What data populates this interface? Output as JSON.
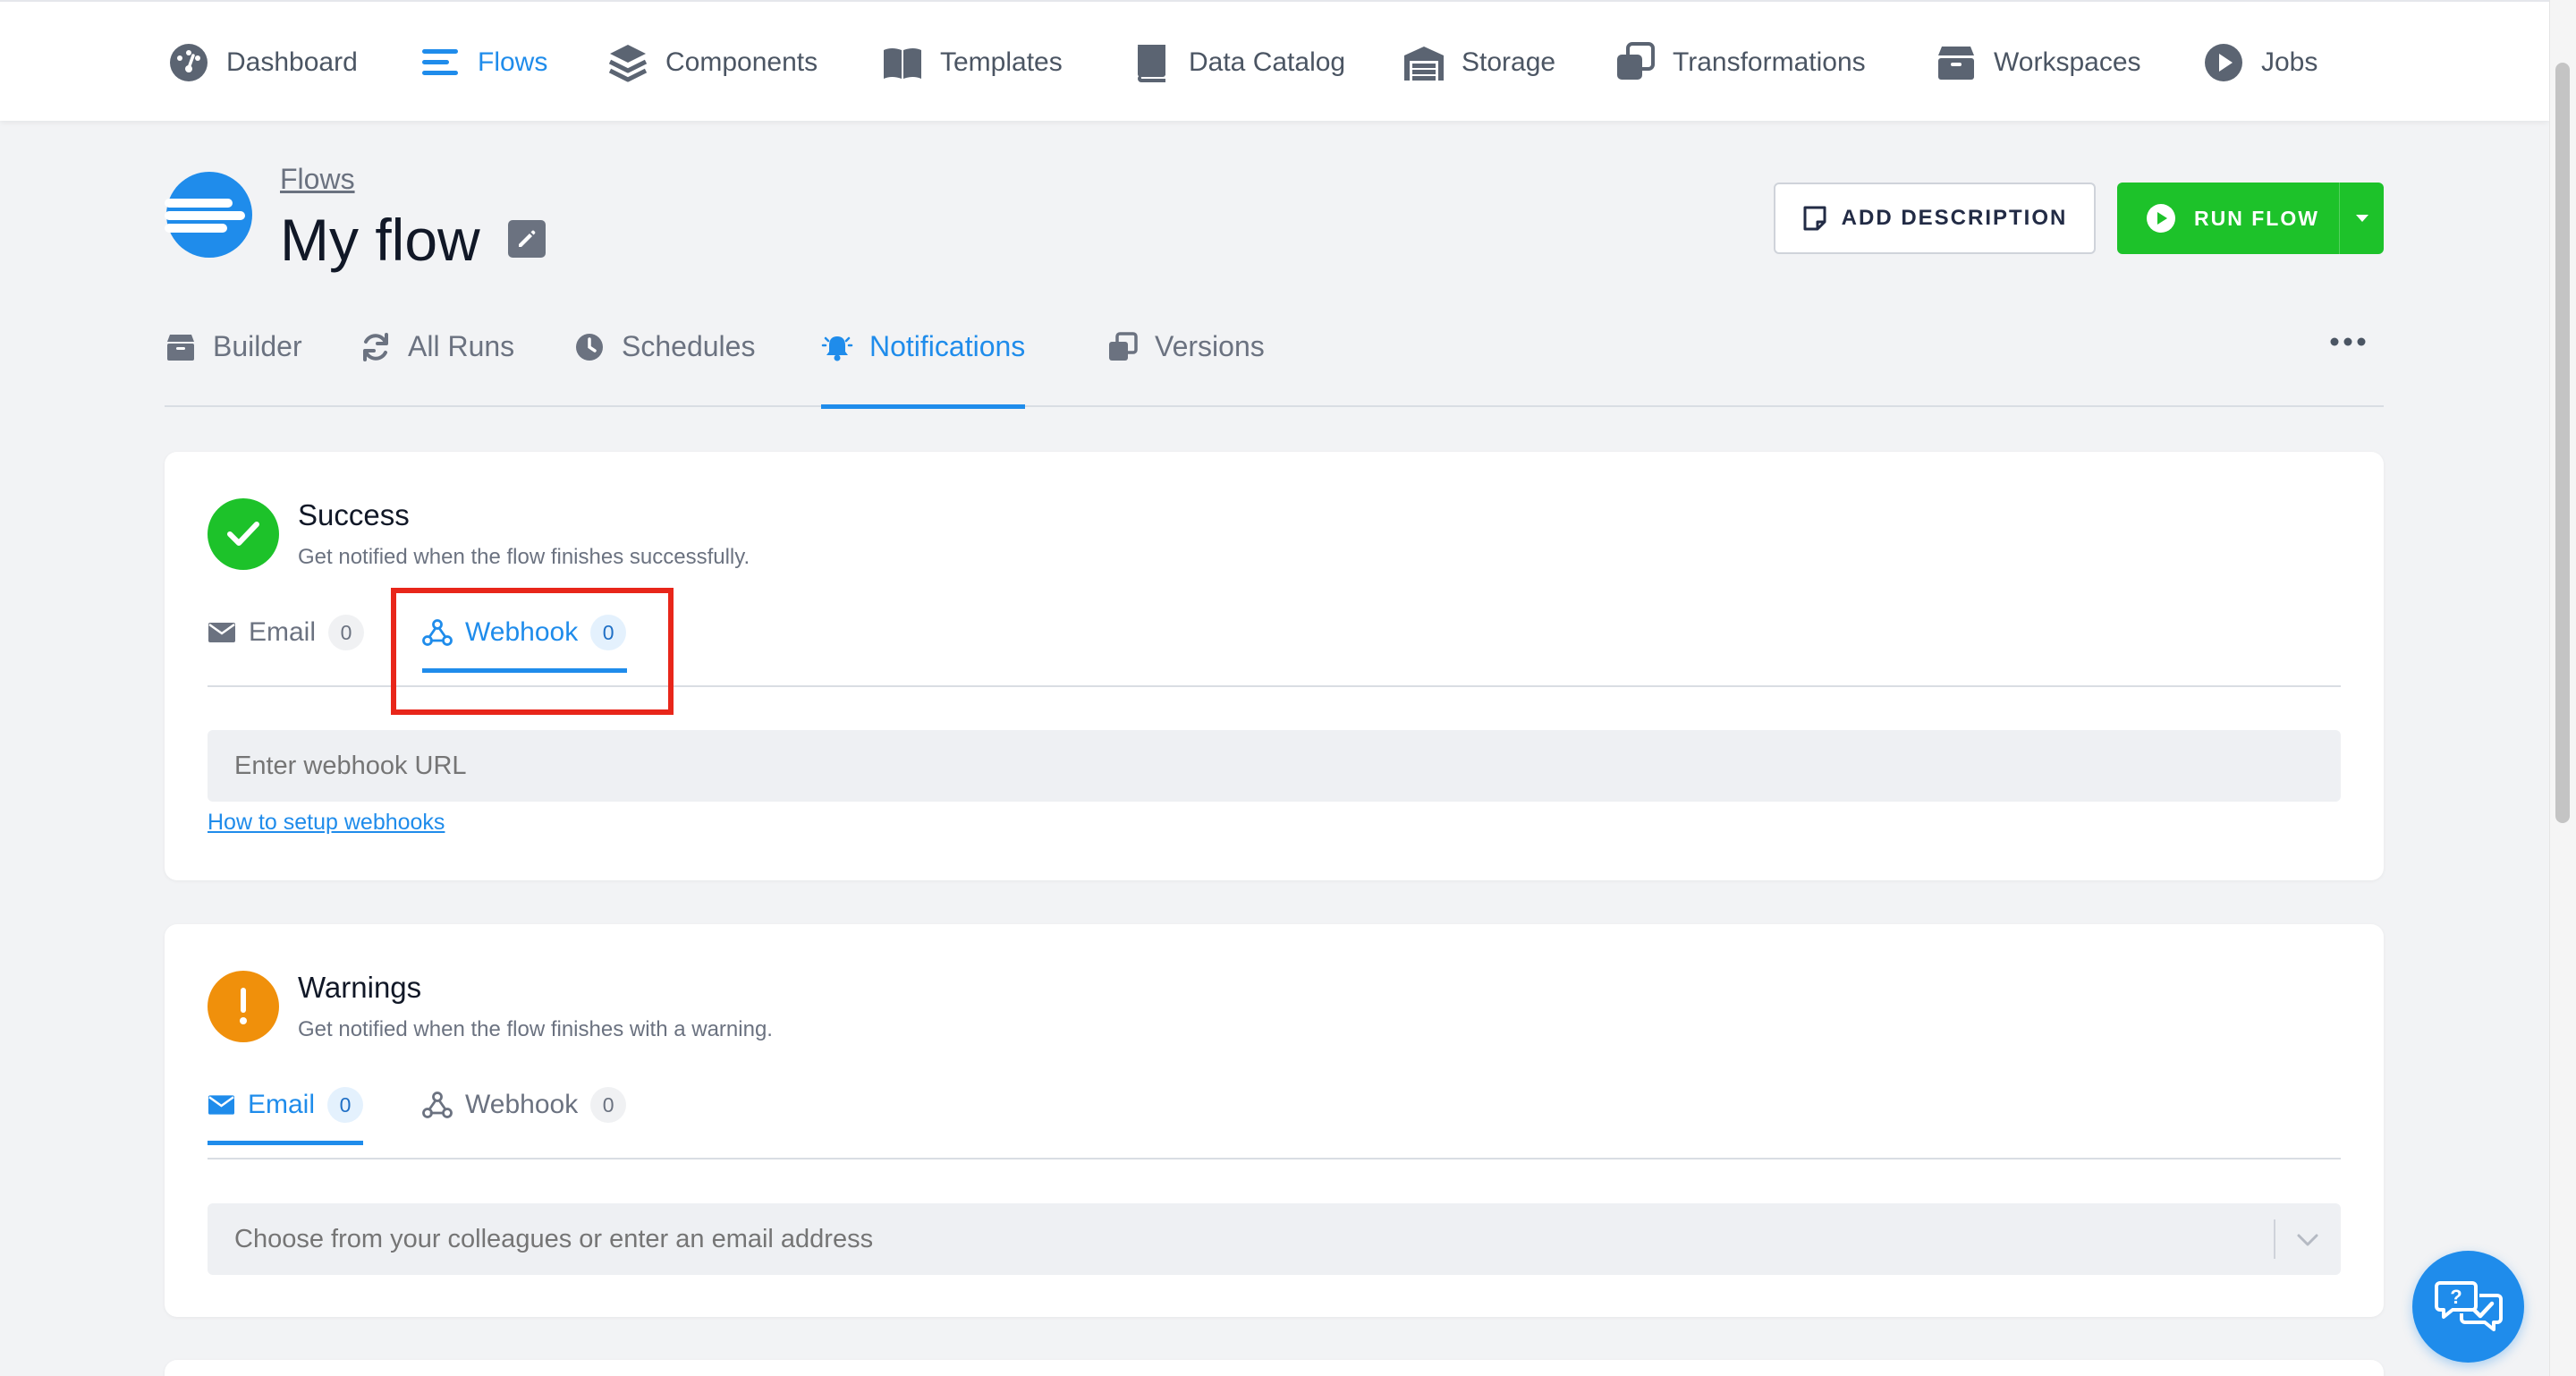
{
  "nav": {
    "items": [
      {
        "label": "Dashboard",
        "icon": "dashboard-icon"
      },
      {
        "label": "Flows",
        "icon": "flows-icon",
        "active": true
      },
      {
        "label": "Components",
        "icon": "components-icon"
      },
      {
        "label": "Templates",
        "icon": "templates-icon"
      },
      {
        "label": "Data Catalog",
        "icon": "data-catalog-icon"
      },
      {
        "label": "Storage",
        "icon": "storage-icon"
      },
      {
        "label": "Transformations",
        "icon": "transformations-icon"
      },
      {
        "label": "Workspaces",
        "icon": "workspaces-icon"
      },
      {
        "label": "Jobs",
        "icon": "jobs-icon"
      }
    ]
  },
  "header": {
    "breadcrumb": "Flows",
    "title": "My flow",
    "add_description_label": "ADD DESCRIPTION",
    "run_flow_label": "RUN FLOW"
  },
  "tabs": [
    {
      "label": "Builder",
      "icon": "builder-icon"
    },
    {
      "label": "All Runs",
      "icon": "refresh-icon"
    },
    {
      "label": "Schedules",
      "icon": "clock-icon"
    },
    {
      "label": "Notifications",
      "icon": "bell-icon",
      "active": true
    },
    {
      "label": "Versions",
      "icon": "versions-icon"
    }
  ],
  "success": {
    "title": "Success",
    "description": "Get notified when the flow finishes successfully.",
    "tabs": [
      {
        "label": "Email",
        "count": "0"
      },
      {
        "label": "Webhook",
        "count": "0",
        "active": true
      }
    ],
    "webhook_placeholder": "Enter webhook URL",
    "help_link": "How to setup webhooks"
  },
  "warnings": {
    "title": "Warnings",
    "description": "Get notified when the flow finishes with a warning.",
    "tabs": [
      {
        "label": "Email",
        "count": "0",
        "active": true
      },
      {
        "label": "Webhook",
        "count": "0"
      }
    ],
    "email_placeholder": "Choose from your colleagues or enter an email address"
  },
  "colors": {
    "accent": "#1f8ceb",
    "success": "#1dc22a",
    "warning": "#f0900b",
    "highlight": "#e8261a"
  }
}
